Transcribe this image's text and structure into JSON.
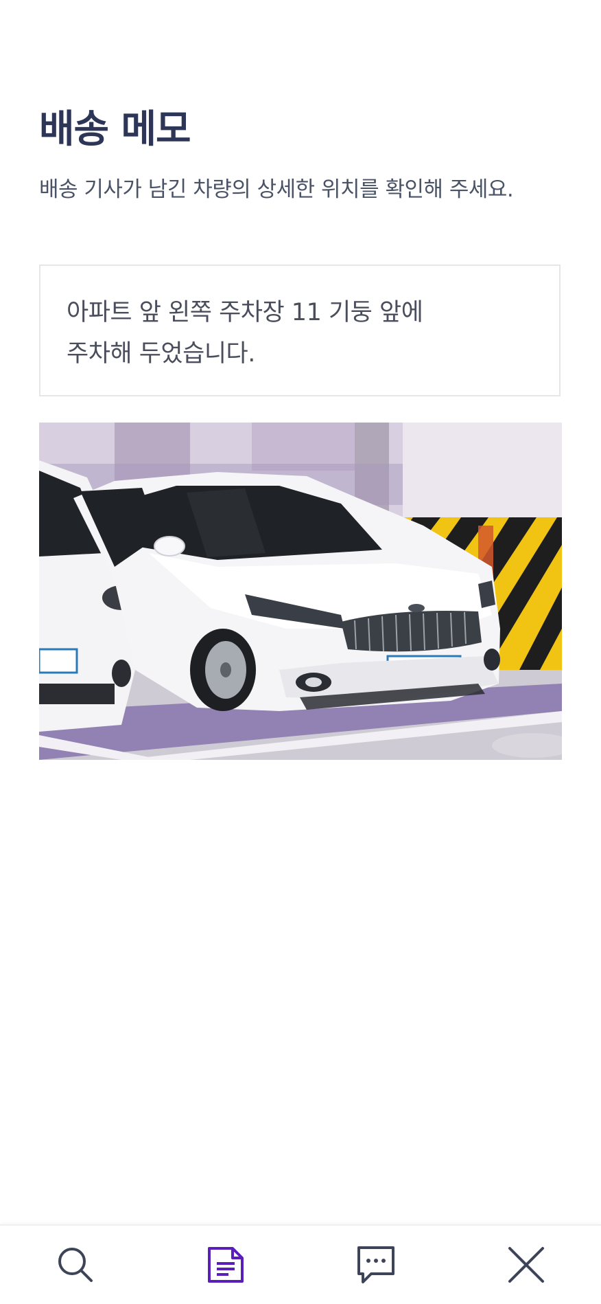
{
  "page": {
    "title": "배송 메모",
    "subtitle": "배송 기사가 남긴 차량의 상세한 위치를 확인해 주세요."
  },
  "memo": {
    "lines": [
      "아파트 앞 왼쪽 주차장 11 기둥 앞에",
      "주차해 두었습니다."
    ]
  },
  "nav": {
    "items": [
      {
        "icon": "search-icon",
        "active": false
      },
      {
        "icon": "document-icon",
        "active": true
      },
      {
        "icon": "chat-icon",
        "active": false
      },
      {
        "icon": "close-icon",
        "active": false
      }
    ]
  },
  "colors": {
    "title": "#2e3658",
    "subtitle": "#4a5366",
    "memo_text": "#4a4e5c",
    "memo_border": "#e6e6ea",
    "nav_icon": "#3e4458",
    "nav_active": "#5a1fb8"
  }
}
